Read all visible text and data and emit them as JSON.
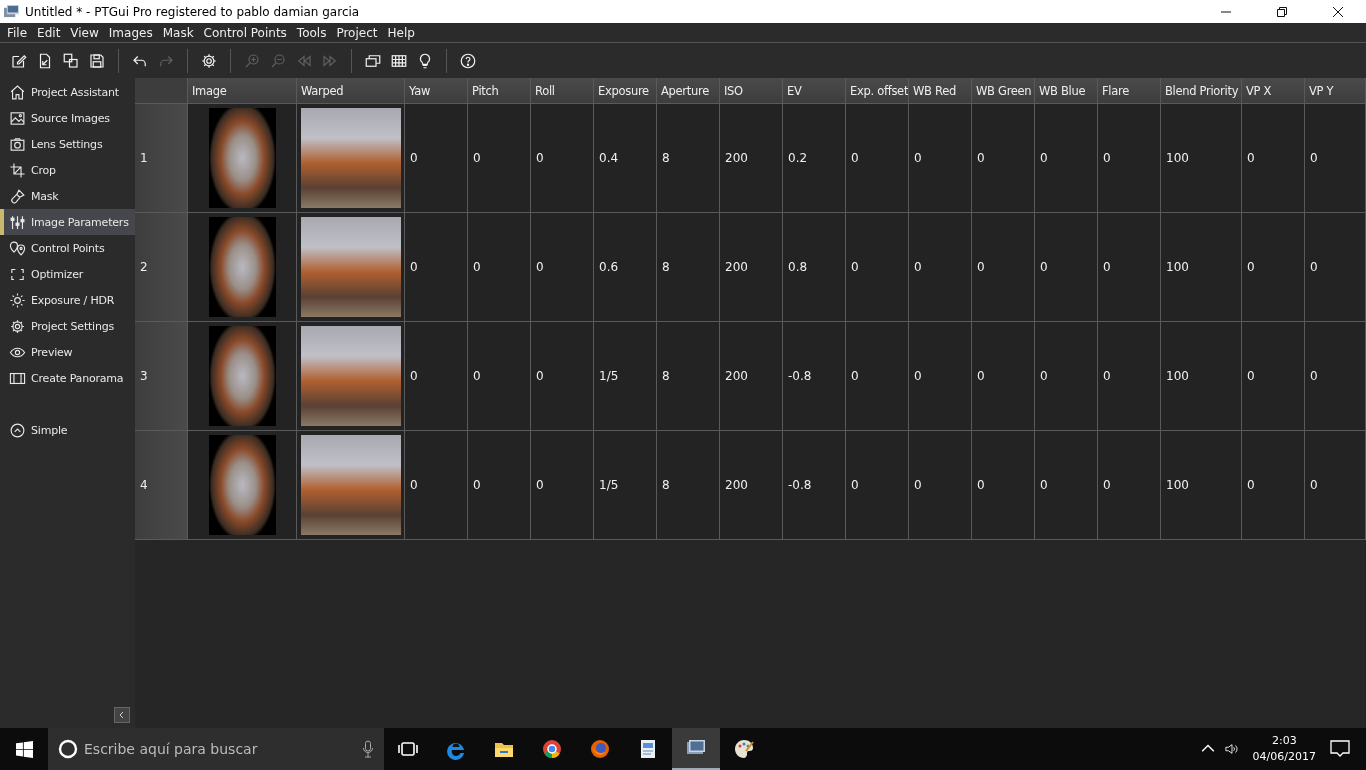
{
  "window": {
    "title": "Untitled * - PTGui Pro registered to pablo damian garcia"
  },
  "menu": [
    "File",
    "Edit",
    "View",
    "Images",
    "Mask",
    "Control Points",
    "Tools",
    "Project",
    "Help"
  ],
  "toolbar": [
    {
      "kind": "new",
      "disabled": false
    },
    {
      "kind": "open",
      "disabled": false
    },
    {
      "kind": "copy",
      "disabled": false
    },
    {
      "kind": "save",
      "disabled": false
    },
    {
      "kind": "separator"
    },
    {
      "kind": "undo",
      "disabled": false
    },
    {
      "kind": "redo",
      "disabled": true
    },
    {
      "kind": "separator"
    },
    {
      "kind": "settings",
      "disabled": false
    },
    {
      "kind": "separator"
    },
    {
      "kind": "zoomin",
      "disabled": true
    },
    {
      "kind": "zoomout",
      "disabled": true
    },
    {
      "kind": "rewind",
      "disabled": true
    },
    {
      "kind": "forward",
      "disabled": true
    },
    {
      "kind": "separator"
    },
    {
      "kind": "editor",
      "disabled": false
    },
    {
      "kind": "grid",
      "disabled": false
    },
    {
      "kind": "bulb",
      "disabled": false
    },
    {
      "kind": "separator"
    },
    {
      "kind": "help",
      "disabled": false
    }
  ],
  "sidebar": {
    "items": [
      {
        "label": "Project Assistant",
        "kind": "home",
        "selected": false
      },
      {
        "label": "Source Images",
        "kind": "images",
        "selected": false
      },
      {
        "label": "Lens Settings",
        "kind": "camera",
        "selected": false
      },
      {
        "label": "Crop",
        "kind": "crop",
        "selected": false
      },
      {
        "label": "Mask",
        "kind": "brush",
        "selected": false
      },
      {
        "label": "Image Parameters",
        "kind": "sliders",
        "selected": true
      },
      {
        "label": "Control Points",
        "kind": "pins",
        "selected": false
      },
      {
        "label": "Optimizer",
        "kind": "optimizer",
        "selected": false
      },
      {
        "label": "Exposure / HDR",
        "kind": "sun",
        "selected": false
      },
      {
        "label": "Project Settings",
        "kind": "gear",
        "selected": false
      },
      {
        "label": "Preview",
        "kind": "eye",
        "selected": false
      },
      {
        "label": "Create Panorama",
        "kind": "panorama",
        "selected": false
      }
    ],
    "mode_toggle": {
      "label": "Simple"
    }
  },
  "table": {
    "columns": [
      "Image",
      "Warped",
      "Yaw",
      "Pitch",
      "Roll",
      "Exposure",
      "Aperture",
      "ISO",
      "EV",
      "Exp. offset",
      "WB Red",
      "WB Green",
      "WB Blue",
      "Flare",
      "Blend Priority",
      "VP X",
      "VP Y"
    ],
    "rows": [
      {
        "number": "1",
        "values": [
          "0",
          "0",
          "0",
          "0.4",
          "8",
          "200",
          "0.2",
          "0",
          "0",
          "0",
          "0",
          "0",
          "100",
          "0",
          "0"
        ]
      },
      {
        "number": "2",
        "values": [
          "0",
          "0",
          "0",
          "0.6",
          "8",
          "200",
          "0.8",
          "0",
          "0",
          "0",
          "0",
          "0",
          "100",
          "0",
          "0"
        ]
      },
      {
        "number": "3",
        "values": [
          "0",
          "0",
          "0",
          "1/5",
          "8",
          "200",
          "-0.8",
          "0",
          "0",
          "0",
          "0",
          "0",
          "100",
          "0",
          "0"
        ]
      },
      {
        "number": "4",
        "values": [
          "0",
          "0",
          "0",
          "1/5",
          "8",
          "200",
          "-0.8",
          "0",
          "0",
          "0",
          "0",
          "0",
          "100",
          "0",
          "0"
        ]
      }
    ]
  },
  "taskbar": {
    "search": {
      "placeholder": "Escribe aquí para buscar"
    },
    "apps": [
      {
        "kind": "taskview",
        "selected": false
      },
      {
        "kind": "edge",
        "selected": false
      },
      {
        "kind": "folder",
        "selected": false
      },
      {
        "kind": "chrome",
        "selected": false
      },
      {
        "kind": "firefox",
        "selected": false
      },
      {
        "kind": "document",
        "selected": false
      },
      {
        "kind": "ptgui",
        "selected": true
      },
      {
        "kind": "paint",
        "selected": false
      }
    ],
    "time": "2:03",
    "date": "04/06/2017"
  }
}
